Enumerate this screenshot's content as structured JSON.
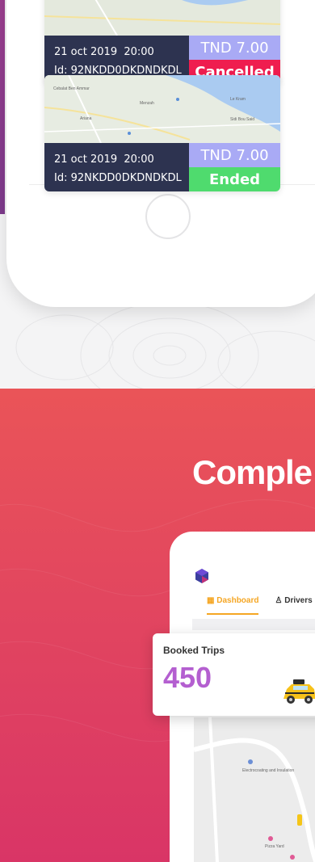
{
  "trips": [
    {
      "date": "21 oct 2019",
      "time": "20:00",
      "id_label": "Id:",
      "id": "92NKDD0DKDNDKDL",
      "price": "TND 7.00",
      "status": "Cancelled",
      "status_color": "#ef1d4f"
    },
    {
      "date": "21 oct 2019",
      "time": "20:00",
      "id_label": "Id:",
      "id": "92NKDD0DKDNDKDL",
      "price": "TND 7.00",
      "status": "Ended",
      "status_color": "#4fdb6e",
      "map_labels": [
        "Cebalat Ben Ammar",
        "Ariana",
        "Menzah",
        "Le Kram",
        "Sidi Bou Said"
      ]
    }
  ],
  "section": {
    "heading": "Comple"
  },
  "dashboard": {
    "tabs": [
      {
        "label": "Dashboard",
        "icon": "grid-icon",
        "active": true
      },
      {
        "label": "Drivers",
        "icon": "driver-icon",
        "active": false
      }
    ],
    "stat": {
      "label": "Booked Trips",
      "value": "450"
    },
    "map_labels": [
      "Electrocoating and Insulation",
      "Pizza Yard"
    ]
  },
  "colors": {
    "card_dark": "#2d3350",
    "price_bg": "#a9aaf5",
    "cancelled": "#ef1d4f",
    "ended": "#4fdb6e",
    "accent_tab": "#f5a623",
    "stat_value": "#b45fd0"
  }
}
